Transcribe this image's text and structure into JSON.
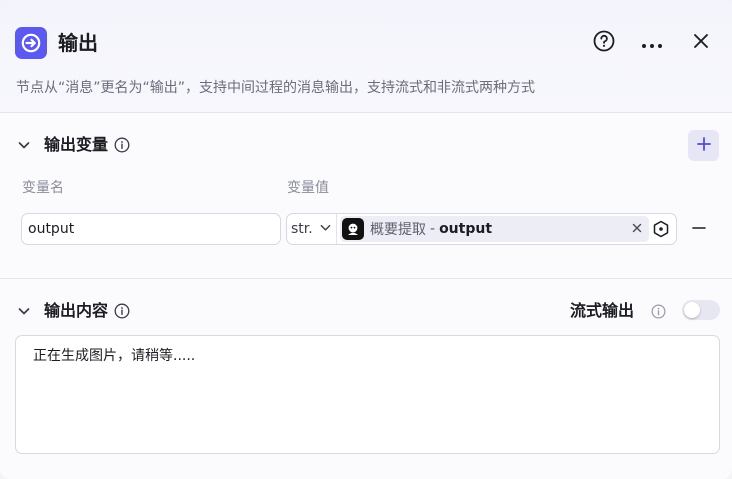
{
  "header": {
    "title": "输出",
    "description": "节点从“消息”更名为“输出”，支持中间过程的消息输出，支持流式和非流式两种方式",
    "icons": {
      "node": "output-arrow-icon",
      "help": "help-circle-icon",
      "more": "more-dots-icon",
      "close": "close-icon"
    }
  },
  "output_variables": {
    "title": "输出变量",
    "column_name_label": "变量名",
    "column_value_label": "变量值",
    "rows": [
      {
        "name": "output",
        "type": "str.",
        "ref_node": "概要提取",
        "ref_separator": "-",
        "ref_var": "output"
      }
    ]
  },
  "output_content": {
    "title": "输出内容",
    "stream_label": "流式输出",
    "stream_enabled": false,
    "text": "正在生成图片，请稍等....."
  },
  "colors": {
    "accent": "#5b59f0",
    "add_button_bg": "#e6e6f7",
    "ref_tag_bg": "#ededf6"
  }
}
